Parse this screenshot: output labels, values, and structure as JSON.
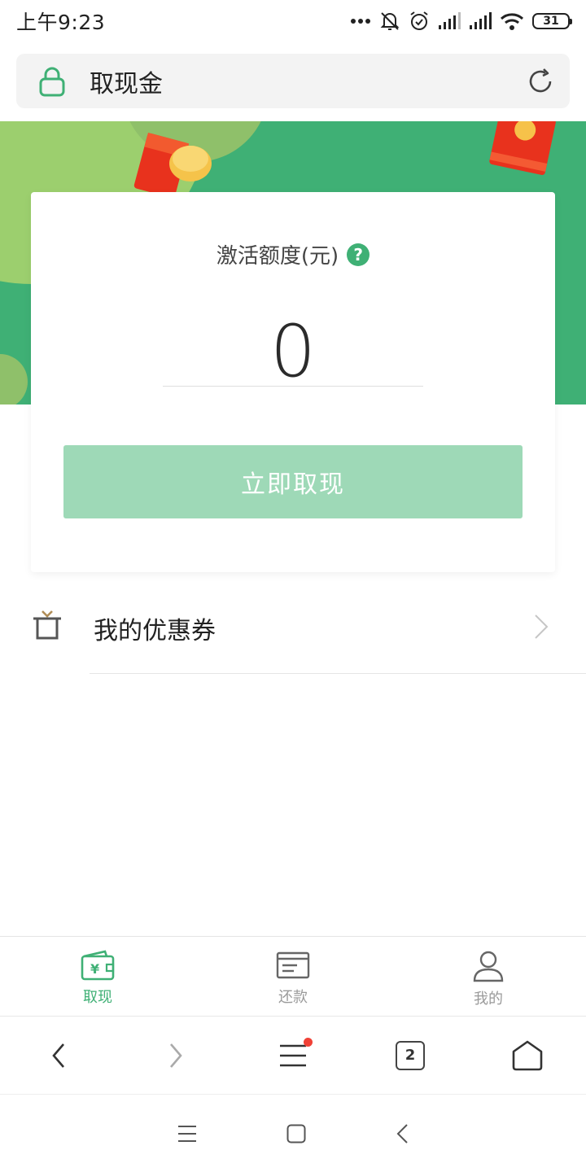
{
  "status_bar": {
    "time": "上午9:23",
    "battery": "31"
  },
  "address_bar": {
    "title": "取现金"
  },
  "card": {
    "quota_label": "激活额度(元)",
    "help_symbol": "?",
    "amount": "0",
    "withdraw_button": "立即取现"
  },
  "coupons": {
    "label": "我的优惠券"
  },
  "tabs": [
    {
      "label": "取现",
      "icon": "wallet-yen-icon",
      "active": true
    },
    {
      "label": "还款",
      "icon": "bill-icon",
      "active": false
    },
    {
      "label": "我的",
      "icon": "person-icon",
      "active": false
    }
  ],
  "browser_bar": {
    "tab_count": "2"
  },
  "colors": {
    "brand_green": "#3fb075",
    "button_disabled_green": "#9ed9b7",
    "notification_red": "#f04136"
  }
}
